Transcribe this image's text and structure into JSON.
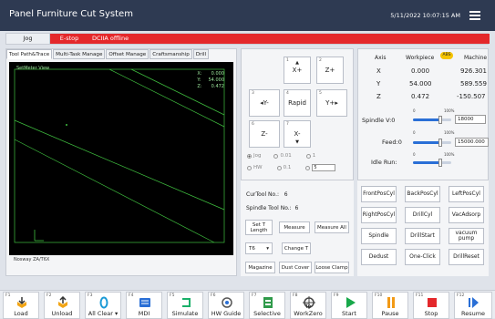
{
  "titlebar": {
    "app_title": "Panel Furniture Cut System",
    "datetime": "5/11/2022 10:07:15 AM"
  },
  "status": {
    "jog_label": "Jog",
    "estop_label": "E-stop",
    "offline_text": "DCIIA offline"
  },
  "tabs": [
    "Tool Path&Trace",
    "Multi-Task Manage",
    "Offset Manage",
    "Craftsmanship",
    "Drill"
  ],
  "viewport": {
    "view_title": "SetMeter View",
    "coords": [
      [
        "X:",
        "0.000"
      ],
      [
        "Y:",
        "54.000"
      ],
      [
        "Z:",
        "0.472"
      ]
    ],
    "status_text": "Nosway ZA/T6X"
  },
  "jog": {
    "xplus": "X+",
    "zplus": "Z+",
    "yminus": "Y-",
    "rapid": "Rapid",
    "yplus": "Y+",
    "zminus": "Z-",
    "xminus": "X-",
    "modes": [
      "Jog",
      "0.01",
      "1"
    ],
    "modes2": [
      "HW",
      "0.1",
      "5"
    ],
    "step_value": "5"
  },
  "toolinfo": {
    "cur_tool_label": "CurTool No.:",
    "cur_tool_value": "6",
    "spindle_tool_label": "Spindle Tool No.:",
    "spindle_tool_value": "6",
    "set_length": "Set T Length",
    "measure": "Measure",
    "measure_all": "Measure All",
    "tool_select": "T6",
    "change": "Change T",
    "magazine": "Magazine",
    "dust_cover": "Dust Cover",
    "loose_clamp": "Loose Clamp"
  },
  "axes": {
    "hdr_axis": "Axis",
    "hdr_workpiece": "Workpiece",
    "hdr_badge": "ABS",
    "hdr_machine": "Machine",
    "rows": [
      {
        "axis": "X",
        "work": "0.000",
        "machine": "926.301"
      },
      {
        "axis": "Y",
        "work": "54.000",
        "machine": "589.559"
      },
      {
        "axis": "Z",
        "work": "0.472",
        "machine": "-150.507"
      }
    ]
  },
  "sliders": {
    "spindle_label": "Spindle V:0",
    "spindle_value": "18000",
    "spindle_pct": 0.72,
    "feed_label": "Feed:0",
    "feed_value": "15000.000",
    "feed_pct": 0.72,
    "idle_label": "Idle Run:",
    "idle_pct": 0.72,
    "tick_0": "0",
    "tick_100": "100%"
  },
  "buttons": [
    "FrontPosCyl",
    "BackPosCyl",
    "LeftPosCyl",
    "RightPosCyl",
    "DrillCyl",
    "VacAdsorp",
    "Spindle",
    "DrillStart",
    "vacuum pump",
    "Dedust",
    "One-Click",
    "DrillReset"
  ],
  "fkeys": [
    {
      "fn": "F1",
      "label": "Load",
      "icon": "load-icon"
    },
    {
      "fn": "F2",
      "label": "Unload",
      "icon": "unload-icon"
    },
    {
      "fn": "F3",
      "label": "All Clear",
      "icon": "zero-icon"
    },
    {
      "fn": "F4",
      "label": "MDI",
      "icon": "mdi-icon"
    },
    {
      "fn": "F5",
      "label": "Simulate",
      "icon": "simulate-icon"
    },
    {
      "fn": "F6",
      "label": "HW Guide",
      "icon": "hw-guide-icon"
    },
    {
      "fn": "F7",
      "label": "Selective",
      "icon": "selective-icon"
    },
    {
      "fn": "F8",
      "label": "To WorkZero",
      "icon": "workzero-icon"
    },
    {
      "fn": "F9",
      "label": "Start",
      "icon": "play-icon"
    },
    {
      "fn": "F10",
      "label": "Pause",
      "icon": "pause-icon"
    },
    {
      "fn": "F11",
      "label": "Stop",
      "icon": "stop-icon"
    },
    {
      "fn": "F12",
      "label": "Resume",
      "icon": "resume-icon"
    }
  ],
  "colors": {
    "titlebar": "#2e3a52",
    "estop": "#e4282b",
    "accent": "#2a6fd6",
    "badge": "#f5c400",
    "path": "#3fbf3f"
  }
}
